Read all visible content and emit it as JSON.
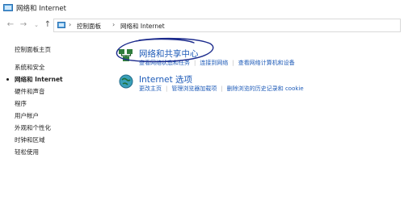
{
  "window": {
    "title": "网络和 Internet"
  },
  "address_bar": {
    "crumbs": [
      "控制面板",
      "网络和 Internet"
    ]
  },
  "sidebar": {
    "items": [
      {
        "label": "控制面板主页",
        "current": false
      },
      {
        "label": "系统和安全",
        "current": false
      },
      {
        "label": "网络和 Internet",
        "current": true
      },
      {
        "label": "硬件和声音",
        "current": false
      },
      {
        "label": "程序",
        "current": false
      },
      {
        "label": "用户帐户",
        "current": false
      },
      {
        "label": "外观和个性化",
        "current": false
      },
      {
        "label": "时钟和区域",
        "current": false
      },
      {
        "label": "轻松使用",
        "current": false
      }
    ]
  },
  "categories": [
    {
      "title": "网络和共享中心",
      "icon": "network-sharing-icon",
      "links": [
        "查看网络状态和任务",
        "连接到网络",
        "查看网络计算机和设备"
      ]
    },
    {
      "title": "Internet 选项",
      "icon": "internet-options-icon",
      "links": [
        "更改主页",
        "管理浏览器加载项",
        "删除浏览的历史记录和 cookie"
      ]
    }
  ],
  "colors": {
    "link": "#1e5bb8",
    "annotation": "#1b2a8c"
  }
}
